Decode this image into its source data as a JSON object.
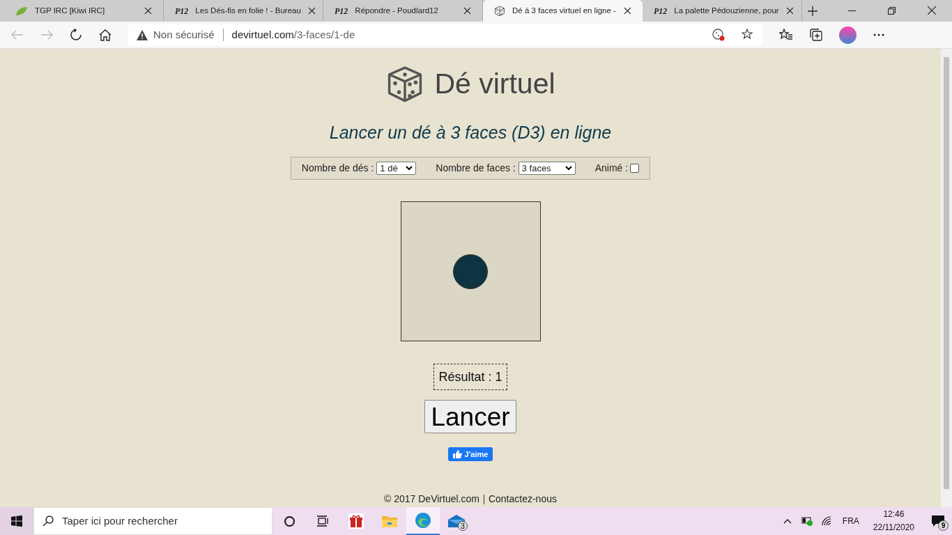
{
  "browser": {
    "tabs": [
      {
        "kind": "leaf",
        "title": "TGP IRC [Kiwi IRC]",
        "selected": false
      },
      {
        "kind": "logo",
        "logo": "P12",
        "title": "Les Dés-fis en folie ! - Bureau",
        "selected": false
      },
      {
        "kind": "logo",
        "logo": "P12",
        "title": "Répondre - Poudlard12",
        "selected": false
      },
      {
        "kind": "die",
        "title": "Dé à 3 faces virtuel en ligne -",
        "selected": true
      },
      {
        "kind": "logo",
        "logo": "P12",
        "title": "La palette Pédouzienne, pour",
        "selected": false
      }
    ],
    "address": {
      "security": "Non sécurisé",
      "domain": "devirtuel.com",
      "path": "/3-faces/1-de"
    }
  },
  "page": {
    "site_title": "Dé virtuel",
    "subtitle": "Lancer un dé à 3 faces (D3) en ligne",
    "controls": {
      "dice_label": "Nombre de dés :",
      "dice_value": "1 dé",
      "faces_label": "Nombre de faces :",
      "faces_value": "3 faces",
      "animated_label": "Animé :",
      "animated": false
    },
    "result": "Résultat : 1",
    "roll_button": "Lancer",
    "like_button": "J'aime",
    "footer": {
      "copyright": "© 2017 DeVirtuel.com",
      "link": "Contactez-nous"
    }
  },
  "taskbar": {
    "search_placeholder": "Taper ici pour rechercher",
    "mail_badge": "3",
    "language": "FRA",
    "time": "12:46",
    "date": "22/11/2020",
    "notifications": "9"
  }
}
